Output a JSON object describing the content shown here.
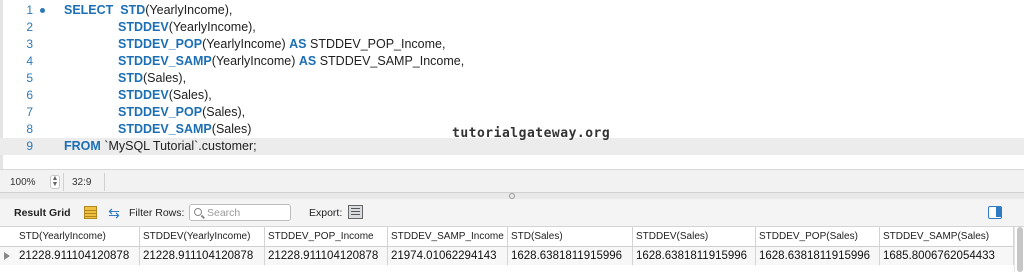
{
  "editor": {
    "lines": [
      {
        "num": "1",
        "parts": [
          {
            "t": "SELECT",
            "k": true
          },
          {
            "t": "  "
          },
          {
            "t": "STD",
            "k": true
          },
          {
            "t": "(YearlyIncome),"
          }
        ]
      },
      {
        "num": "2",
        "parts": [
          {
            "t": "STDDEV",
            "k": true
          },
          {
            "t": "(YearlyIncome),"
          }
        ]
      },
      {
        "num": "3",
        "parts": [
          {
            "t": "STDDEV_POP",
            "k": true
          },
          {
            "t": "(YearlyIncome) "
          },
          {
            "t": "AS",
            "k": true
          },
          {
            "t": " STDDEV_POP_Income,"
          }
        ]
      },
      {
        "num": "4",
        "parts": [
          {
            "t": "STDDEV_SAMP",
            "k": true
          },
          {
            "t": "(YearlyIncome) "
          },
          {
            "t": "AS",
            "k": true
          },
          {
            "t": " STDDEV_SAMP_Income,"
          }
        ]
      },
      {
        "num": "5",
        "parts": [
          {
            "t": "STD",
            "k": true
          },
          {
            "t": "(Sales),"
          }
        ]
      },
      {
        "num": "6",
        "parts": [
          {
            "t": "STDDEV",
            "k": true
          },
          {
            "t": "(Sales),"
          }
        ]
      },
      {
        "num": "7",
        "parts": [
          {
            "t": "STDDEV_POP",
            "k": true
          },
          {
            "t": "(Sales),"
          }
        ]
      },
      {
        "num": "8",
        "parts": [
          {
            "t": "STDDEV_SAMP",
            "k": true
          },
          {
            "t": "(Sales)"
          }
        ]
      },
      {
        "num": "9",
        "parts": [
          {
            "t": "FROM",
            "k": true
          },
          {
            "t": " `MySQL Tutorial`.customer;"
          }
        ]
      }
    ],
    "watermark": "tutorialgateway.org"
  },
  "status": {
    "zoom": "100%",
    "cursor": "32:9"
  },
  "results": {
    "title": "Result Grid",
    "filter_label": "Filter Rows:",
    "search_placeholder": "Search",
    "export_label": "Export:",
    "columns": [
      "STD(YearlyIncome)",
      "STDDEV(YearlyIncome)",
      "STDDEV_POP_Income",
      "STDDEV_SAMP_Income",
      "STD(Sales)",
      "STDDEV(Sales)",
      "STDDEV_POP(Sales)",
      "STDDEV_SAMP(Sales)"
    ],
    "rows": [
      [
        "21228.911104120878",
        "21228.911104120878",
        "21228.911104120878",
        "21974.01062294143",
        "1628.6381811915996",
        "1628.6381811915996",
        "1628.6381811915996",
        "1685.8006762054433"
      ]
    ]
  }
}
